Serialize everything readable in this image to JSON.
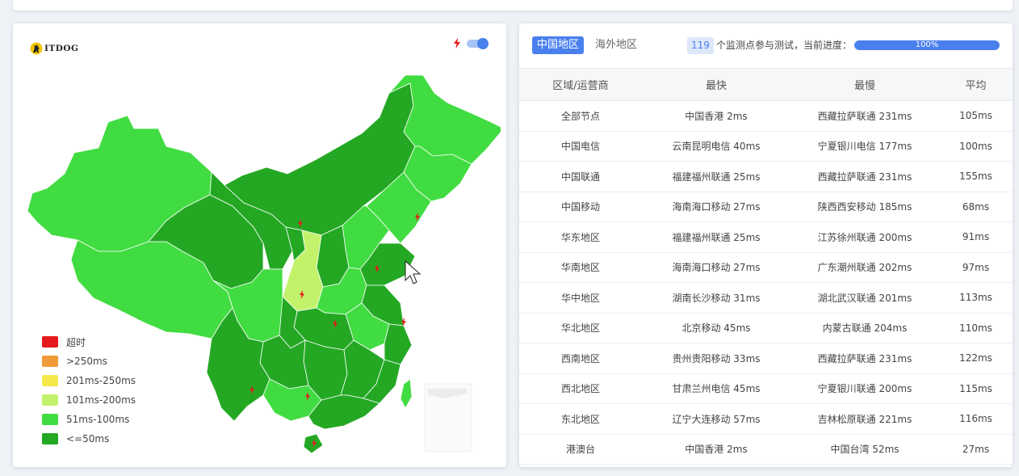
{
  "logo": {
    "text": "ITDOG"
  },
  "tabs": {
    "active": "中国地区",
    "inactive": "海外地区"
  },
  "monitor": {
    "count": "119",
    "text": "个监测点参与测试，当前进度：",
    "progress_label": "100%",
    "progress": 1.0
  },
  "table": {
    "headers": [
      "区域/运营商",
      "最快",
      "最慢",
      "平均"
    ],
    "rows": [
      [
        "全部节点",
        "中国香港 2ms",
        "西藏拉萨联通 231ms",
        "105ms"
      ],
      [
        "中国电信",
        "云南昆明电信 40ms",
        "宁夏银川电信 177ms",
        "100ms"
      ],
      [
        "中国联通",
        "福建福州联通 25ms",
        "西藏拉萨联通 231ms",
        "155ms"
      ],
      [
        "中国移动",
        "海南海口移动 27ms",
        "陕西西安移动 185ms",
        "68ms"
      ],
      [
        "华东地区",
        "福建福州联通 25ms",
        "江苏徐州联通 200ms",
        "91ms"
      ],
      [
        "华南地区",
        "海南海口移动 27ms",
        "广东潮州联通 202ms",
        "97ms"
      ],
      [
        "华中地区",
        "湖南长沙移动 31ms",
        "湖北武汉联通 201ms",
        "113ms"
      ],
      [
        "华北地区",
        "北京移动 45ms",
        "内蒙古联通 204ms",
        "110ms"
      ],
      [
        "西南地区",
        "贵州贵阳移动 33ms",
        "西藏拉萨联通 231ms",
        "122ms"
      ],
      [
        "西北地区",
        "甘肃兰州电信 45ms",
        "宁夏银川联通 200ms",
        "115ms"
      ],
      [
        "东北地区",
        "辽宁大连移动 57ms",
        "吉林松原联通 221ms",
        "116ms"
      ],
      [
        "港澳台",
        "中国香港 2ms",
        "中国台湾 52ms",
        "27ms"
      ]
    ]
  },
  "legend": [
    {
      "label": "超时",
      "color": "#e5191c"
    },
    {
      "label": ">250ms",
      "color": "#f09a38"
    },
    {
      "label": "201ms-250ms",
      "color": "#f5e84a"
    },
    {
      "label": "101ms-200ms",
      "color": "#c2f26a"
    },
    {
      "label": "51ms-100ms",
      "color": "#41dc41"
    },
    {
      "label": "<=50ms",
      "color": "#24a824"
    }
  ],
  "colors": {
    "accent": "#4a80ee",
    "dark_green": "#24a824",
    "light_green": "#41dc41",
    "yellow_green": "#c2f26a",
    "alert_red": "#e5191c"
  },
  "icons": {
    "lightning": "lightning-icon",
    "logo": "dog-logo-icon"
  }
}
